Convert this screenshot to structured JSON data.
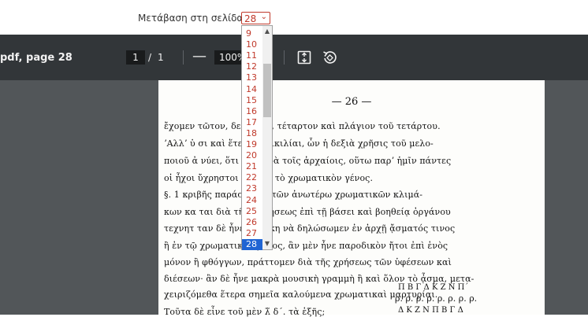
{
  "goto": {
    "label": "Μετάβαση στη σελίδα",
    "selected": "28"
  },
  "dropdown": {
    "options": [
      "9",
      "10",
      "11",
      "12",
      "13",
      "14",
      "15",
      "16",
      "17",
      "18",
      "19",
      "20",
      "21",
      "22",
      "23",
      "24",
      "25",
      "26",
      "27",
      "28"
    ],
    "selected_index": 19
  },
  "toolbar": {
    "title": "pdf, page 28",
    "current_page": "1",
    "page_separator": "/",
    "total_pages": "1",
    "zoom_out_symbol": "—",
    "zoom_value": "100%",
    "icons": [
      "fit-to-page-icon",
      "rotate-icon"
    ]
  },
  "page": {
    "number": "— 26 —",
    "lines": [
      "ἔχομεν        τῶτον, δεύτερον, τέταρτον καὶ πλάγιον τοῦ τετάρτου.",
      "ʼΑλλʼ ὑ       σι  καὶ ἕτεραι ποικιλίαι, ὧν ἡ δεξιὰ χρῆσις τοῦ μελο-",
      "ποιοῦ ἀ       νύει, ὅτι ὡς παρὰ τοῖς ἀρχαίοις, οὕτω παρʼ ἡμῖν πάντες",
      "οἱ ἦχοι        ὔχρηστοι καὶ εἰς τὸ χρωματικὸν γένος.",
      "   §. 1       κριβῆς παράστασις τῶν ἀνωτέρω χρωματικῶν κλιμά-",
      "κων κα        ται διὰ τῆς ἀσκήσεως ἐπὶ τῇ βάσει καὶ βοηθείᾳ ὀργάνου",
      "τεχνητ        ταν δὲ ἦνε ἀνάγκη νὰ δηλώσωμεν ἐν ἀρχῇ ᾄσματός τινος",
      "ἢ ἐν τῷ       χρωματικὸν μέλος, ἂν μὲν ἦνε παροδικὸν ἤτοι ἐπὶ ἑνὸς",
      "μόνον ἢ        φθόγγων, πράττομεν διὰ τῆς χρήσεως τῶν ὑφέσεων καὶ",
      "διέσεων· ἂν δὲ ἦνε μακρὰ μουσικὴ γραμμὴ ἢ καὶ ὅλον τὸ ᾆσμα, μετα-",
      "χειριζόμεθα ἕτερα σημεῖα καλούμενα χρωματικαὶ μαρτυρίαι.",
      "   Τοῦτα δὲ εἶνε τοῦ μὲν λ̃ δ΄. τὰ ἑξῆς;"
    ],
    "notation_top": "Π   Β   Γ   Δ   Κ   Ζ   Ν   Π΄",
    "notation_marks": "ρ. ρ. ρ. ρ. ρ. ρ. ρ. ρ.",
    "notation_bottom": "Δ   Κ   Ζ   Ν   Π   Β   Γ   Δ"
  },
  "colors": {
    "accent": "#c0392b",
    "toolbar": "#323639",
    "canvas": "#525659",
    "selection": "#1f64d3"
  }
}
